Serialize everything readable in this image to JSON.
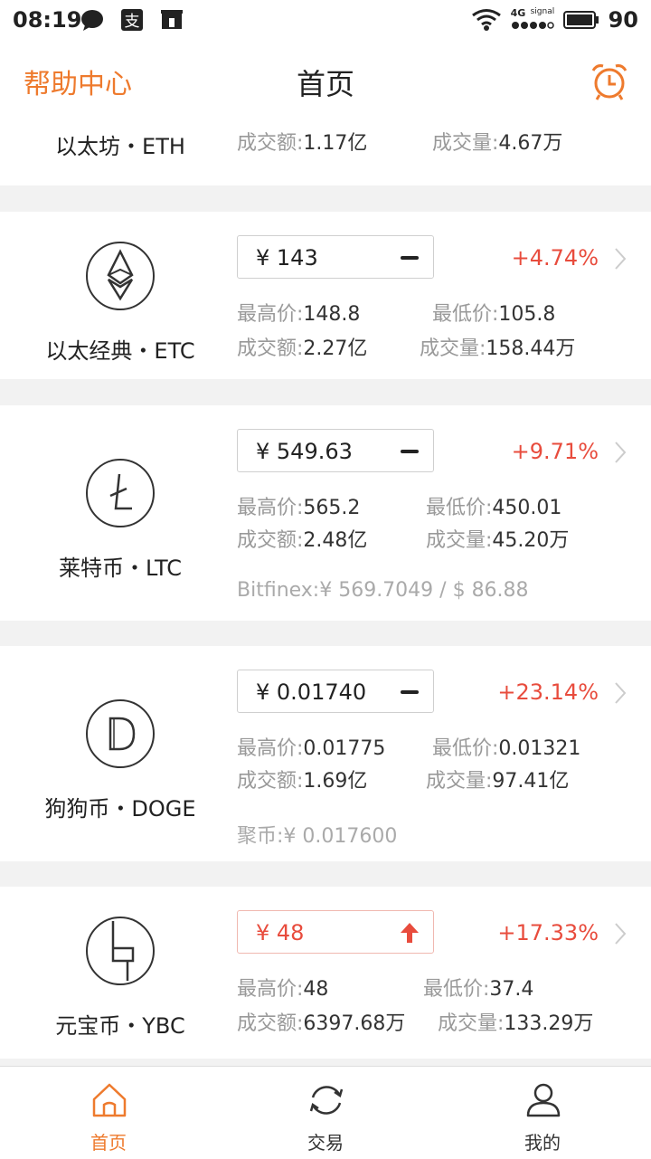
{
  "status_bar": {
    "time": "08:19",
    "network": "4G",
    "signal_label": "signal",
    "battery": "90"
  },
  "header": {
    "left_link": "帮助中心",
    "title": "首页"
  },
  "colors": {
    "accent": "#ee7a2d",
    "up": "#e84c3d"
  },
  "coins": [
    {
      "name": "以太坊・ETH",
      "stats": [
        {
          "label": "成交额:",
          "value": "1.17亿"
        },
        {
          "label": "成交量:",
          "value": "4.67万"
        }
      ]
    },
    {
      "name": "以太经典・ETC",
      "price": "¥  143",
      "trend": "flat",
      "change": "+4.74%",
      "stats": [
        {
          "label": "最高价:",
          "value": "148.8"
        },
        {
          "label": "最低价:",
          "value": "105.8"
        },
        {
          "label": "成交额:",
          "value": "2.27亿"
        },
        {
          "label": "成交量:",
          "value": "158.44万"
        }
      ]
    },
    {
      "name": "莱特币・LTC",
      "price": "¥  549.63",
      "trend": "flat",
      "change": "+9.71%",
      "stats": [
        {
          "label": "最高价:",
          "value": "565.2"
        },
        {
          "label": "最低价:",
          "value": "450.01"
        },
        {
          "label": "成交额:",
          "value": "2.48亿"
        },
        {
          "label": "成交量:",
          "value": "45.20万"
        }
      ],
      "source": "Bitfinex:¥ 569.7049 / $ 86.88"
    },
    {
      "name": "狗狗币・DOGE",
      "price": "¥  0.01740",
      "trend": "flat",
      "change": "+23.14%",
      "stats": [
        {
          "label": "最高价:",
          "value": "0.01775"
        },
        {
          "label": "最低价:",
          "value": "0.01321"
        },
        {
          "label": "成交额:",
          "value": "1.69亿"
        },
        {
          "label": "成交量:",
          "value": "97.41亿"
        }
      ],
      "source": "聚币:¥ 0.017600"
    },
    {
      "name": "元宝币・YBC",
      "price": "¥  48",
      "trend": "up",
      "change": "+17.33%",
      "stats": [
        {
          "label": "最高价:",
          "value": "48"
        },
        {
          "label": "最低价:",
          "value": "37.4"
        },
        {
          "label": "成交额:",
          "value": "6397.68万"
        },
        {
          "label": "成交量:",
          "value": "133.29万"
        }
      ]
    }
  ],
  "nav": [
    {
      "label": "首页",
      "icon": "home-icon",
      "active": true
    },
    {
      "label": "交易",
      "icon": "exchange-icon",
      "active": false
    },
    {
      "label": "我的",
      "icon": "user-icon",
      "active": false
    }
  ]
}
